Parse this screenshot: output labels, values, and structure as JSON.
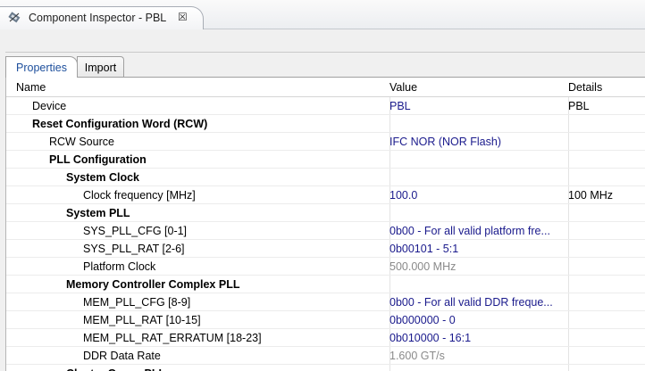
{
  "window": {
    "title": "Component Inspector - PBL",
    "close_symbol": "☒",
    "icon": "component-inspector-icon"
  },
  "tabs": [
    {
      "label": "Properties",
      "active": true
    },
    {
      "label": "Import",
      "active": false
    }
  ],
  "columns": {
    "name": "Name",
    "value": "Value",
    "details": "Details"
  },
  "rows": [
    {
      "name": "Device",
      "level": 1,
      "bold": false,
      "value": "PBL",
      "value_style": "normal",
      "details": "PBL"
    },
    {
      "name": "Reset Configuration Word (RCW)",
      "level": 1,
      "bold": true,
      "value": "",
      "value_style": "normal",
      "details": ""
    },
    {
      "name": "RCW Source",
      "level": 2,
      "bold": false,
      "value": "IFC NOR (NOR Flash)",
      "value_style": "normal",
      "details": ""
    },
    {
      "name": "PLL Configuration",
      "level": 2,
      "bold": true,
      "value": "",
      "value_style": "normal",
      "details": ""
    },
    {
      "name": "System Clock",
      "level": 3,
      "bold": true,
      "value": "",
      "value_style": "normal",
      "details": ""
    },
    {
      "name": "Clock frequency [MHz]",
      "level": 4,
      "bold": false,
      "value": "100.0",
      "value_style": "normal",
      "details": "100 MHz"
    },
    {
      "name": "System PLL",
      "level": 3,
      "bold": true,
      "value": "",
      "value_style": "normal",
      "details": ""
    },
    {
      "name": "SYS_PLL_CFG   [0-1]",
      "level": 4,
      "bold": false,
      "value": "0b00 - For all valid platform fre...",
      "value_style": "normal",
      "details": ""
    },
    {
      "name": "SYS_PLL_RAT   [2-6]",
      "level": 4,
      "bold": false,
      "value": "0b00101 - 5:1",
      "value_style": "normal",
      "details": ""
    },
    {
      "name": "Platform Clock",
      "level": 4,
      "bold": false,
      "value": "500.000 MHz",
      "value_style": "disabled",
      "details": ""
    },
    {
      "name": "Memory Controller Complex PLL",
      "level": 3,
      "bold": true,
      "value": "",
      "value_style": "normal",
      "details": ""
    },
    {
      "name": "MEM_PLL_CFG   [8-9]",
      "level": 4,
      "bold": false,
      "value": "0b00 - For all valid DDR freque...",
      "value_style": "normal",
      "details": ""
    },
    {
      "name": "MEM_PLL_RAT   [10-15]",
      "level": 4,
      "bold": false,
      "value": "0b000000 - 0",
      "value_style": "normal",
      "details": ""
    },
    {
      "name": "MEM_PLL_RAT_ERRATUM   [18-23]",
      "level": 4,
      "bold": false,
      "value": "0b010000 - 16:1",
      "value_style": "normal",
      "details": ""
    },
    {
      "name": "DDR Data Rate",
      "level": 4,
      "bold": false,
      "value": "1.600 GT/s",
      "value_style": "disabled",
      "details": ""
    },
    {
      "name": "Cluster Group PLL",
      "level": 3,
      "bold": true,
      "value": "",
      "value_style": "normal",
      "details": ""
    }
  ],
  "colors": {
    "value_text": "#1a1a8c",
    "disabled_text": "#8a8a8a",
    "active_tab_text": "#1d4f9c"
  }
}
